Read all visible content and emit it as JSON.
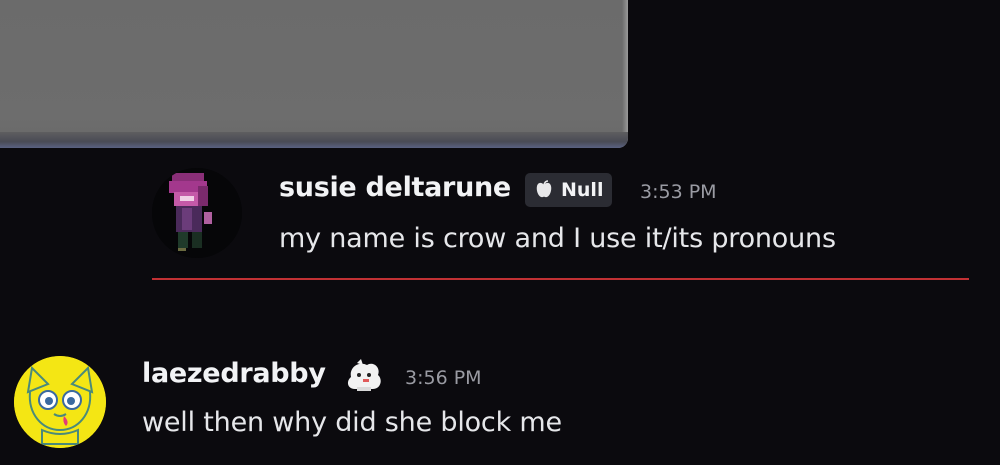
{
  "messages": [
    {
      "username": "susie deltarune",
      "tag": "Null",
      "timestamp": "3:53 PM",
      "content": "my name is crow and I use it/its pronouns"
    },
    {
      "username": "laezedrabby",
      "timestamp": "3:56 PM",
      "content": "well then why did she block me"
    }
  ],
  "colors": {
    "background": "#0b0a0e",
    "divider": "#c23134",
    "username": "#f2f3f5",
    "timestamp": "#9a9ba3",
    "tag_background": "#2b2c33"
  },
  "icons": {
    "tag_icon": "apple-icon",
    "user_badge": "pet-badge-icon"
  }
}
